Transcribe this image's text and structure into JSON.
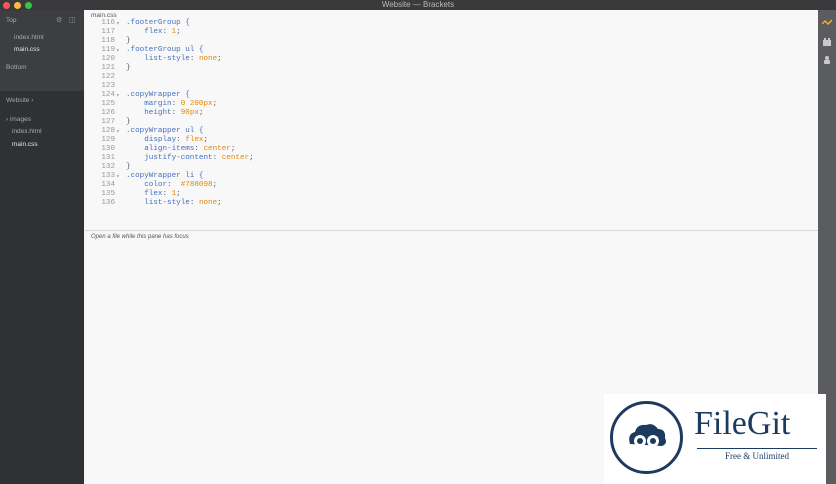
{
  "window": {
    "title": "Website — Brackets"
  },
  "sidebar": {
    "working_files_header": "Top",
    "working_files": [
      "index.html",
      "main.css"
    ],
    "bottom_label": "Bottom",
    "project_title": "Website",
    "tree": [
      "images",
      "index.html",
      "main.css"
    ]
  },
  "editor": {
    "tab": "main.css",
    "lines": [
      {
        "num": "116",
        "fold": "▾",
        "parts": [
          {
            "t": ".footerGroup {",
            "c": "sel"
          }
        ]
      },
      {
        "num": "117",
        "fold": "",
        "parts": [
          {
            "t": "    ",
            "c": ""
          },
          {
            "t": "flex",
            "c": "prop"
          },
          {
            "t": ": ",
            "c": ""
          },
          {
            "t": "1",
            "c": "val"
          },
          {
            "t": ";",
            "c": ""
          }
        ]
      },
      {
        "num": "118",
        "fold": "",
        "parts": [
          {
            "t": "}",
            "c": ""
          }
        ]
      },
      {
        "num": "119",
        "fold": "▾",
        "parts": [
          {
            "t": ".footerGroup ul {",
            "c": "sel"
          }
        ]
      },
      {
        "num": "120",
        "fold": "",
        "parts": [
          {
            "t": "    ",
            "c": ""
          },
          {
            "t": "list-style",
            "c": "prop"
          },
          {
            "t": ": ",
            "c": ""
          },
          {
            "t": "none",
            "c": "val"
          },
          {
            "t": ";",
            "c": ""
          }
        ]
      },
      {
        "num": "121",
        "fold": "",
        "parts": [
          {
            "t": "}",
            "c": ""
          }
        ]
      },
      {
        "num": "122",
        "fold": "",
        "parts": []
      },
      {
        "num": "123",
        "fold": "",
        "parts": []
      },
      {
        "num": "124",
        "fold": "▾",
        "parts": [
          {
            "t": ".copyWrapper {",
            "c": "sel"
          }
        ]
      },
      {
        "num": "125",
        "fold": "",
        "parts": [
          {
            "t": "    ",
            "c": ""
          },
          {
            "t": "margin",
            "c": "prop"
          },
          {
            "t": ": ",
            "c": ""
          },
          {
            "t": "0 200px",
            "c": "val"
          },
          {
            "t": ";",
            "c": ""
          }
        ]
      },
      {
        "num": "126",
        "fold": "",
        "parts": [
          {
            "t": "    ",
            "c": ""
          },
          {
            "t": "height",
            "c": "prop"
          },
          {
            "t": ": ",
            "c": ""
          },
          {
            "t": "90px",
            "c": "val"
          },
          {
            "t": ";",
            "c": ""
          }
        ]
      },
      {
        "num": "127",
        "fold": "",
        "parts": [
          {
            "t": "}",
            "c": ""
          }
        ]
      },
      {
        "num": "128",
        "fold": "▾",
        "parts": [
          {
            "t": ".copyWrapper ul {",
            "c": "sel"
          }
        ]
      },
      {
        "num": "129",
        "fold": "",
        "parts": [
          {
            "t": "    ",
            "c": ""
          },
          {
            "t": "display",
            "c": "prop"
          },
          {
            "t": ": ",
            "c": ""
          },
          {
            "t": "flex",
            "c": "val"
          },
          {
            "t": ";",
            "c": ""
          }
        ]
      },
      {
        "num": "130",
        "fold": "",
        "parts": [
          {
            "t": "    ",
            "c": ""
          },
          {
            "t": "align-items",
            "c": "prop"
          },
          {
            "t": ": ",
            "c": ""
          },
          {
            "t": "center",
            "c": "val"
          },
          {
            "t": ";",
            "c": ""
          }
        ]
      },
      {
        "num": "131",
        "fold": "",
        "parts": [
          {
            "t": "    ",
            "c": ""
          },
          {
            "t": "justify-content",
            "c": "prop"
          },
          {
            "t": ": ",
            "c": ""
          },
          {
            "t": "center",
            "c": "val"
          },
          {
            "t": ";",
            "c": ""
          }
        ]
      },
      {
        "num": "132",
        "fold": "",
        "parts": [
          {
            "t": "}",
            "c": ""
          }
        ]
      },
      {
        "num": "133",
        "fold": "▾",
        "parts": [
          {
            "t": ".copyWrapper li {",
            "c": "sel"
          }
        ]
      },
      {
        "num": "134",
        "fold": "",
        "parts": [
          {
            "t": "    ",
            "c": ""
          },
          {
            "t": "color",
            "c": "prop"
          },
          {
            "t": ":  ",
            "c": ""
          },
          {
            "t": "#788098",
            "c": "hex"
          },
          {
            "t": ";",
            "c": ""
          }
        ]
      },
      {
        "num": "135",
        "fold": "",
        "parts": [
          {
            "t": "    ",
            "c": ""
          },
          {
            "t": "flex",
            "c": "prop"
          },
          {
            "t": ": ",
            "c": ""
          },
          {
            "t": "1",
            "c": "val"
          },
          {
            "t": ";",
            "c": ""
          }
        ]
      },
      {
        "num": "136",
        "fold": "",
        "parts": [
          {
            "t": "    ",
            "c": ""
          },
          {
            "t": "list-style",
            "c": "prop"
          },
          {
            "t": ": ",
            "c": ""
          },
          {
            "t": "none",
            "c": "val"
          },
          {
            "t": ";",
            "c": ""
          }
        ]
      }
    ]
  },
  "second_pane": {
    "message": "Open a file while this pane has focus"
  },
  "toolbar": {
    "icons": [
      "live-preview-icon",
      "extension-manager-icon",
      "extensions-icon"
    ]
  },
  "watermark": {
    "name": "FileGit",
    "tagline": "Free & Unlimited"
  },
  "colors": {
    "sidebar_bg": "#45474b",
    "editor_bg": "#f8f8f8",
    "selector": "#446fbd",
    "value": "#e88501",
    "live_preview": "#f5b120",
    "logo": "#1d3a5f"
  }
}
